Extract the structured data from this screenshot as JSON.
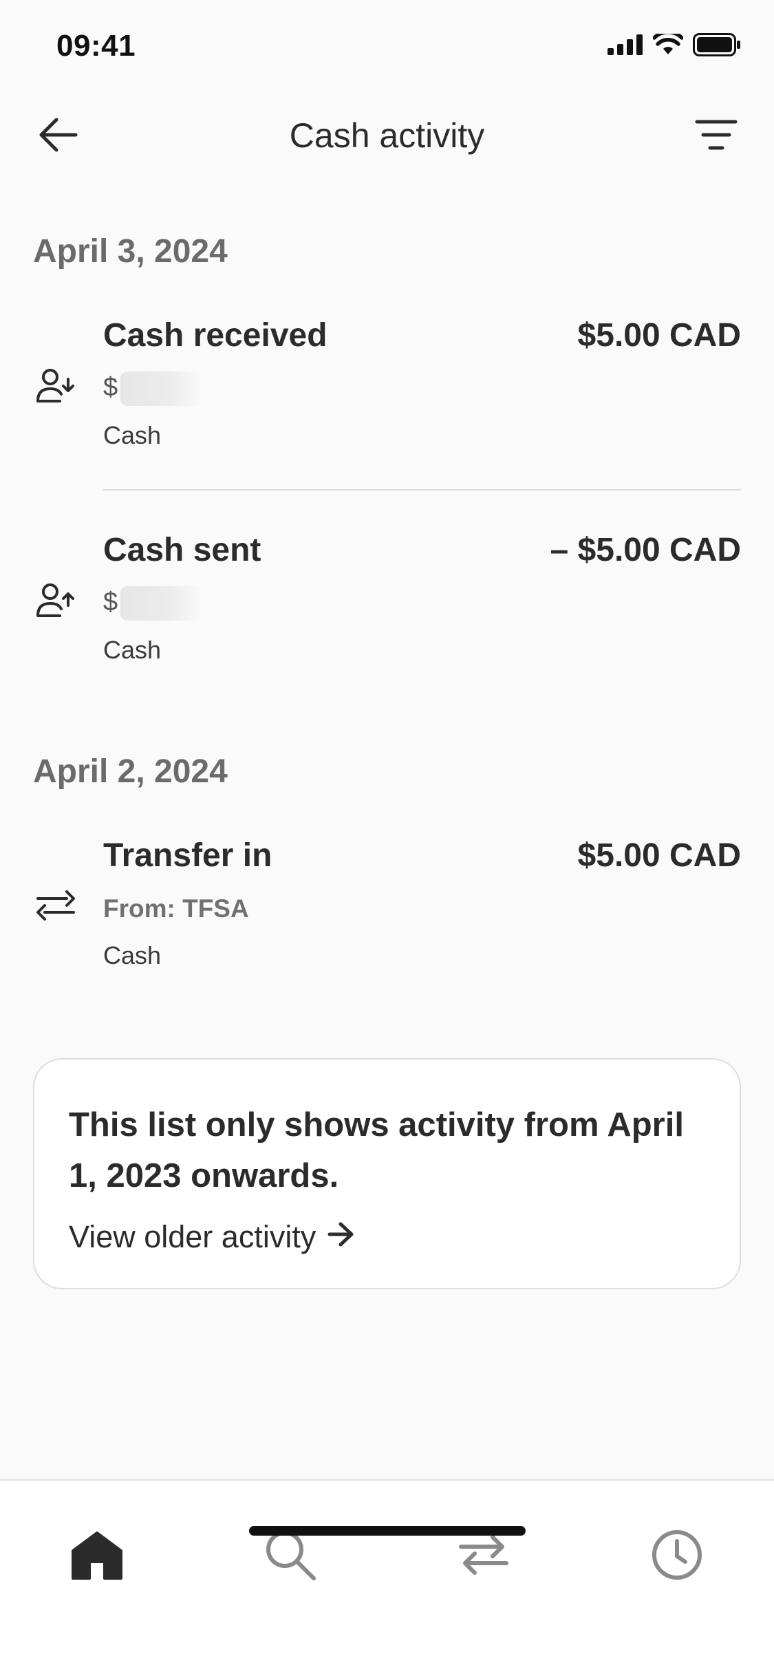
{
  "status_bar": {
    "time": "09:41"
  },
  "header": {
    "title": "Cash activity"
  },
  "groups": [
    {
      "date": "April 3, 2024",
      "items": [
        {
          "icon": "person-receive-icon",
          "title": "Cash received",
          "amount": "$5.00 CAD",
          "sub": "$",
          "account": "Cash"
        },
        {
          "icon": "person-send-icon",
          "title": "Cash sent",
          "amount": "– $5.00 CAD",
          "sub": "$",
          "account": "Cash"
        }
      ]
    },
    {
      "date": "April 2, 2024",
      "items": [
        {
          "icon": "transfer-icon",
          "title": "Transfer in",
          "amount": "$5.00 CAD",
          "sub": "From: TFSA",
          "account": "Cash"
        }
      ]
    }
  ],
  "info_card": {
    "text": "This list only shows activity from April 1, 2023 onwards.",
    "link_label": "View older activity"
  },
  "bottom_nav": [
    {
      "icon": "home-icon",
      "active": true
    },
    {
      "icon": "search-icon",
      "active": false
    },
    {
      "icon": "transfer-icon",
      "active": false
    },
    {
      "icon": "clock-icon",
      "active": false
    }
  ],
  "colors": {
    "background": "#fafafa",
    "text": "#2b2b2b",
    "muted": "#6b6b6b",
    "inactive_icon": "#8a8a8a"
  }
}
